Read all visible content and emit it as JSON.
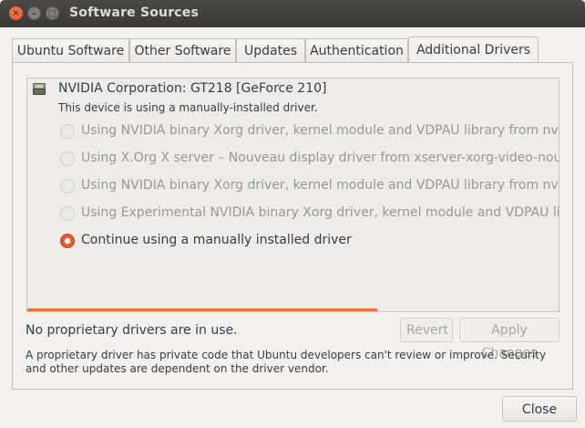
{
  "window": {
    "title": "Software Sources"
  },
  "tabs": [
    {
      "label": "Ubuntu Software"
    },
    {
      "label": "Other Software"
    },
    {
      "label": "Updates"
    },
    {
      "label": "Authentication"
    },
    {
      "label": "Additional Drivers",
      "active": true
    }
  ],
  "device": {
    "name": "NVIDIA Corporation: GT218 [GeForce 210]",
    "status": "This device is using a manually-installed driver."
  },
  "driver_options": [
    {
      "label": "Using NVIDIA binary Xorg driver, kernel module and VDPAU library from nvidia-",
      "selected": false,
      "enabled": false
    },
    {
      "label": "Using X.Org X server – Nouveau display driver from xserver-xorg-video-nouveau",
      "selected": false,
      "enabled": false
    },
    {
      "label": "Using NVIDIA binary Xorg driver, kernel module and VDPAU library from nvidia-",
      "selected": false,
      "enabled": false
    },
    {
      "label": "Using Experimental NVIDIA binary Xorg driver, kernel module and VDPAU librar",
      "selected": false,
      "enabled": false
    },
    {
      "label": "Continue using a manually installed driver",
      "selected": true,
      "enabled": true
    }
  ],
  "status_text": "No proprietary drivers are in use.",
  "buttons": {
    "revert": "Revert",
    "apply": "Apply Changes",
    "close": "Close"
  },
  "note": "A proprietary driver has private code that Ubuntu developers can't review or improve. Security and other updates are dependent on the driver vendor.",
  "colors": {
    "accent": "#e8592a",
    "titlebar": "#3c3b37",
    "progress": "#e8703e"
  }
}
